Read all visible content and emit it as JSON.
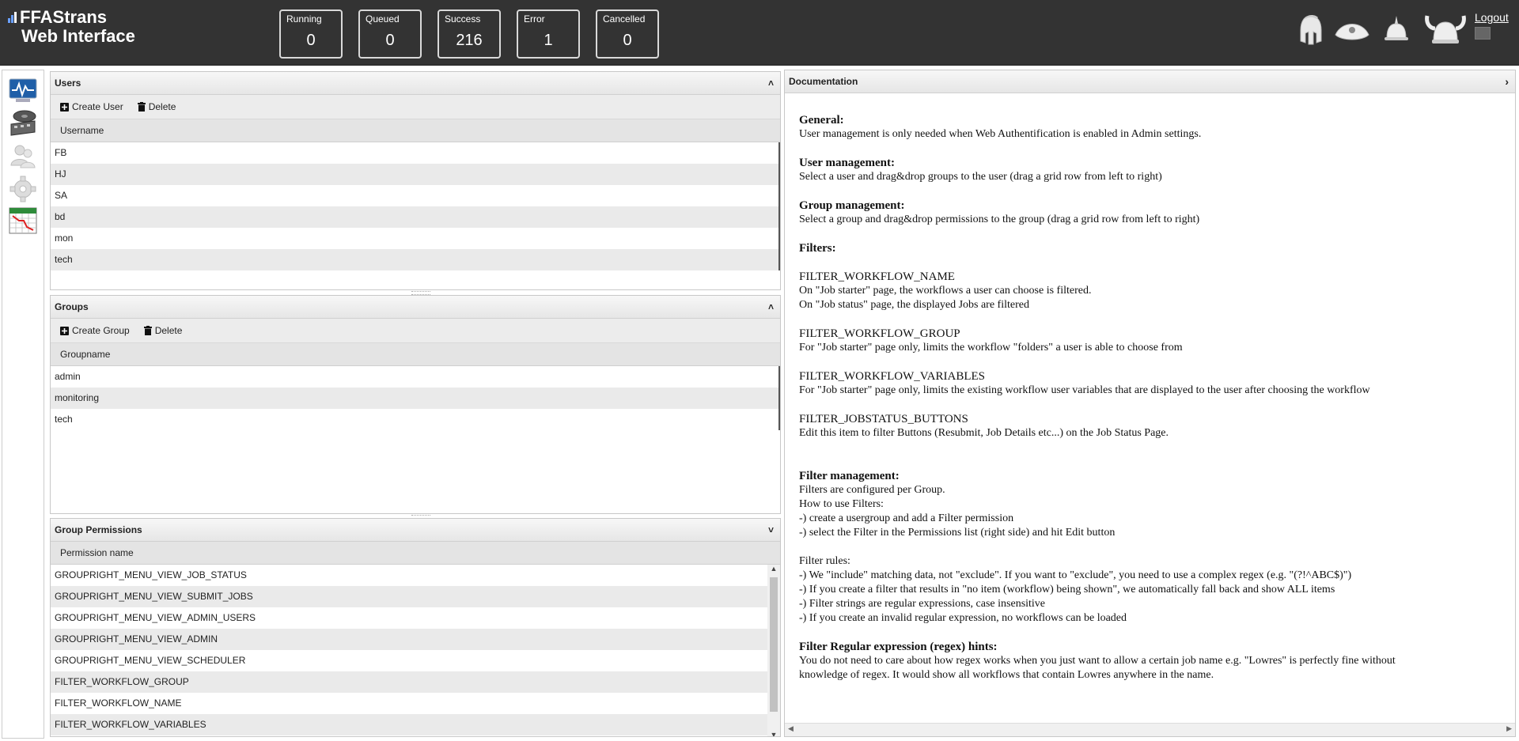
{
  "header": {
    "logo_line1": "FFAStrans",
    "logo_line2": "Web Interface",
    "stats": [
      {
        "label": "Running",
        "value": "0"
      },
      {
        "label": "Queued",
        "value": "0"
      },
      {
        "label": "Success",
        "value": "216"
      },
      {
        "label": "Error",
        "value": "1"
      },
      {
        "label": "Cancelled",
        "value": "0"
      }
    ],
    "logout": "Logout",
    "helmet_icons": [
      "spartan-helmet-icon",
      "bicorne-hat-icon",
      "pickelhaube-icon",
      "viking-helmet-icon"
    ]
  },
  "sidebar": {
    "icons": [
      "monitor-icon",
      "film-reel-icon",
      "users-icon",
      "gear-icon",
      "calendar-icon"
    ]
  },
  "users_panel": {
    "title": "Users",
    "create_label": "Create User",
    "delete_label": "Delete",
    "column": "Username",
    "rows": [
      "FB",
      "HJ",
      "SA",
      "bd",
      "mon",
      "tech"
    ]
  },
  "groups_panel": {
    "title": "Groups",
    "create_label": "Create Group",
    "delete_label": "Delete",
    "column": "Groupname",
    "rows": [
      "admin",
      "monitoring",
      "tech"
    ]
  },
  "permissions_panel": {
    "title": "Group Permissions",
    "column": "Permission name",
    "rows": [
      "GROUPRIGHT_MENU_VIEW_JOB_STATUS",
      "GROUPRIGHT_MENU_VIEW_SUBMIT_JOBS",
      "GROUPRIGHT_MENU_VIEW_ADMIN_USERS",
      "GROUPRIGHT_MENU_VIEW_ADMIN",
      "GROUPRIGHT_MENU_VIEW_SCHEDULER",
      "FILTER_WORKFLOW_GROUP",
      "FILTER_WORKFLOW_NAME",
      "FILTER_WORKFLOW_VARIABLES"
    ]
  },
  "documentation": {
    "title": "Documentation",
    "general_h": "General:",
    "general_1": "User management is only needed when Web Authentification is enabled in Admin settings.",
    "user_h": "User management:",
    "user_1": "Select a user and drag&drop groups to the user (drag a grid row from left to right)",
    "group_h": "Group management:",
    "group_1": "Select a group and drag&drop permissions to the group (drag a grid row from left to right)",
    "filters_h": "Filters:",
    "f1_name": "FILTER_WORKFLOW_NAME",
    "f1_a": "On \"Job starter\" page, the workflows a user can choose is filtered.",
    "f1_b": "On \"Job status\" page, the displayed Jobs are filtered",
    "f2_name": "FILTER_WORKFLOW_GROUP",
    "f2_a": "For \"Job starter\" page only, limits the workflow \"folders\" a user is able to choose from",
    "f3_name": "FILTER_WORKFLOW_VARIABLES",
    "f3_a": "For \"Job starter\" page only, limits the existing workflow user variables that are displayed to the user after choosing the workflow",
    "f4_name": "FILTER_JOBSTATUS_BUTTONS",
    "f4_a": "Edit this item to filter Buttons (Resubmit, Job Details etc...) on the Job Status Page.",
    "fm_h": "Filter management:",
    "fm_1": "Filters are configured per Group.",
    "fm_2": "How to use Filters:",
    "fm_3": "-) create a usergroup and add a Filter permission",
    "fm_4": "-) select the Filter in the Permissions list (right side) and hit Edit button",
    "fr_h": "Filter rules:",
    "fr_1": "-) We \"include\" matching data, not \"exclude\". If you want to \"exclude\", you need to use a complex regex (e.g. \"(?!^ABC$)\")",
    "fr_2": "-) If you create a filter that results in \"no item (workflow) being shown\", we automatically fall back and show ALL items",
    "fr_3": "-) Filter strings are regular expressions, case insensitive",
    "fr_4": "-) If you create an invalid regular expression, no workflows can be loaded",
    "rx_h": "Filter Regular expression (regex) hints:",
    "rx_1": "You do not need to care about how regex works when you just want to allow a certain job name e.g. \"Lowres\" is perfectly fine without",
    "rx_2": "knowledge of regex. It would show all workflows that contain Lowres anywhere in the name."
  }
}
